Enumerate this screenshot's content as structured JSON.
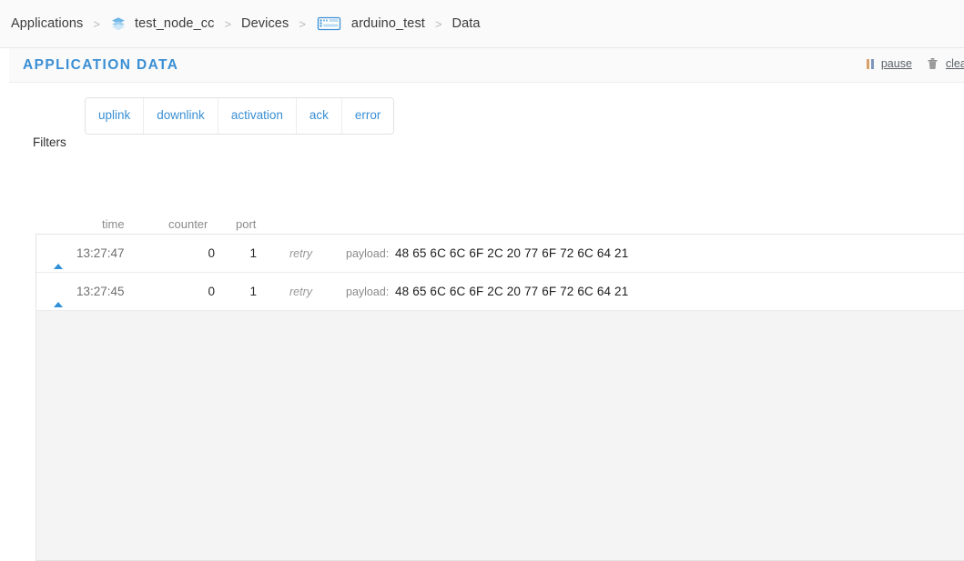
{
  "breadcrumb": {
    "items": [
      {
        "label": "Applications",
        "icon": null
      },
      {
        "label": "test_node_cc",
        "icon": "layers-icon"
      },
      {
        "label": "Devices",
        "icon": null
      },
      {
        "label": "arduino_test",
        "icon": "device-chip-icon"
      },
      {
        "label": "Data",
        "icon": null
      }
    ],
    "separator": ">"
  },
  "panel": {
    "title": "APPLICATION DATA",
    "actions": {
      "pause_label": "pause",
      "pause_icon": "pause-icon",
      "clear_label": "clear",
      "clear_icon": "trash-icon"
    }
  },
  "filters": {
    "label": "Filters",
    "buttons": [
      {
        "label": "uplink"
      },
      {
        "label": "downlink"
      },
      {
        "label": "activation"
      },
      {
        "label": "ack"
      },
      {
        "label": "error"
      }
    ]
  },
  "table": {
    "columns": {
      "time": "time",
      "counter": "counter",
      "port": "port"
    },
    "rows": [
      {
        "direction_icon": "uplink-triangle-icon",
        "time": "13:27:47",
        "counter": "0",
        "port": "1",
        "retry": "retry",
        "payload_label": "payload:",
        "payload": "48 65 6C 6C 6F 2C 20 77 6F 72 6C 64 21"
      },
      {
        "direction_icon": "uplink-triangle-icon",
        "time": "13:27:45",
        "counter": "0",
        "port": "1",
        "retry": "retry",
        "payload_label": "payload:",
        "payload": "48 65 6C 6C 6F 2C 20 77 6F 72 6C 64 21"
      }
    ]
  },
  "colors": {
    "accent": "#3a8fd4",
    "uplink": "#2f8fd8",
    "panel_bg": "#fafafa",
    "table_bg": "#f4f4f5"
  }
}
